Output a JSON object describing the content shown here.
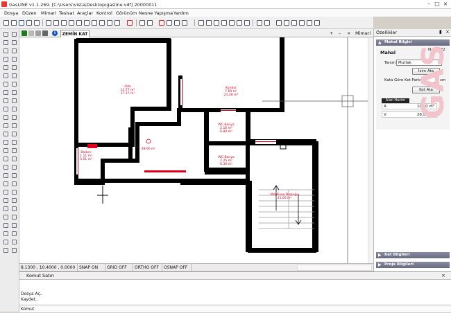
{
  "window": {
    "title": "GasLINE v1.1.269.  [C:\\Users\\vista\\Desktop\\gasline.vdf] 20000011"
  },
  "menu": [
    "Dosya",
    "Düzen",
    "Mimari",
    "Tesisat",
    "Araçlar",
    "Kontrol",
    "Görünüm",
    "Nesne Yapışma",
    "Yardım"
  ],
  "tabs": {
    "active": "ZEMİN KAT",
    "right_label": "Mimari"
  },
  "rooms": [
    {
      "name": "Oda",
      "line1": "12.77 m²",
      "line2": "37.17 m³"
    },
    {
      "name": "Koridor",
      "line1": "7.60 m²",
      "line2": "21.28 m³"
    },
    {
      "name": "",
      "line1": "28.60 m²",
      "line2": ""
    },
    {
      "name": "WC-Banyo",
      "line1": "2.16 m²",
      "line2": "6.80 m³"
    },
    {
      "name": "WC-Banyo",
      "line1": "2.25 m²",
      "line2": "6.30 m³"
    },
    {
      "name": "Balkon",
      "line1": "1.11 m²",
      "line2": "3.01 m³"
    },
    {
      "name": "Merdiven Boşluğu",
      "line1": "11.00 m²",
      "line2": ""
    }
  ],
  "status": {
    "coords": "8.1300 , 10.4000 , 0.0000",
    "snap": "SNAP ON",
    "grid": "GRID OFF",
    "ortho": "ORTHO OFF",
    "osnap": "OSNAP OFF"
  },
  "properties": {
    "title": "Özellikler",
    "section": "Mahal Bilgisi",
    "mahal_label": "Mahal",
    "code": "N.3d 2F2",
    "tanim_label": "Tanım",
    "tanim_value": "Mutfak",
    "isim_ata": "İsim Ata",
    "kot_label": "Kata Göre Kot Farkı",
    "kot_value": "0",
    "kot_unit": "cm",
    "kot_ata": "Kot Ata",
    "alan_tab": "Alan Hacim",
    "a_label": "A",
    "a_value": "10,70 m²",
    "v_label": "V",
    "v_value": "28,90 m³",
    "kat_bilgileri": "Kat Bilgileri",
    "proje_bilgileri": "Proje Bilgileri",
    "watermark": "GAS L"
  },
  "command": {
    "title": "Komut Satırı",
    "lines": [
      "Dosya Aç..",
      "Kaydet.."
    ],
    "prompt": "Komut"
  },
  "colors": {
    "accent": "#e0001b",
    "wall": "#000000"
  },
  "icons": [
    "app-icon",
    "new-icon",
    "open-icon",
    "save-icon",
    "print-icon",
    "undo-icon",
    "redo-icon",
    "zoom-icon",
    "info-icon",
    "pin-icon",
    "close-icon"
  ]
}
